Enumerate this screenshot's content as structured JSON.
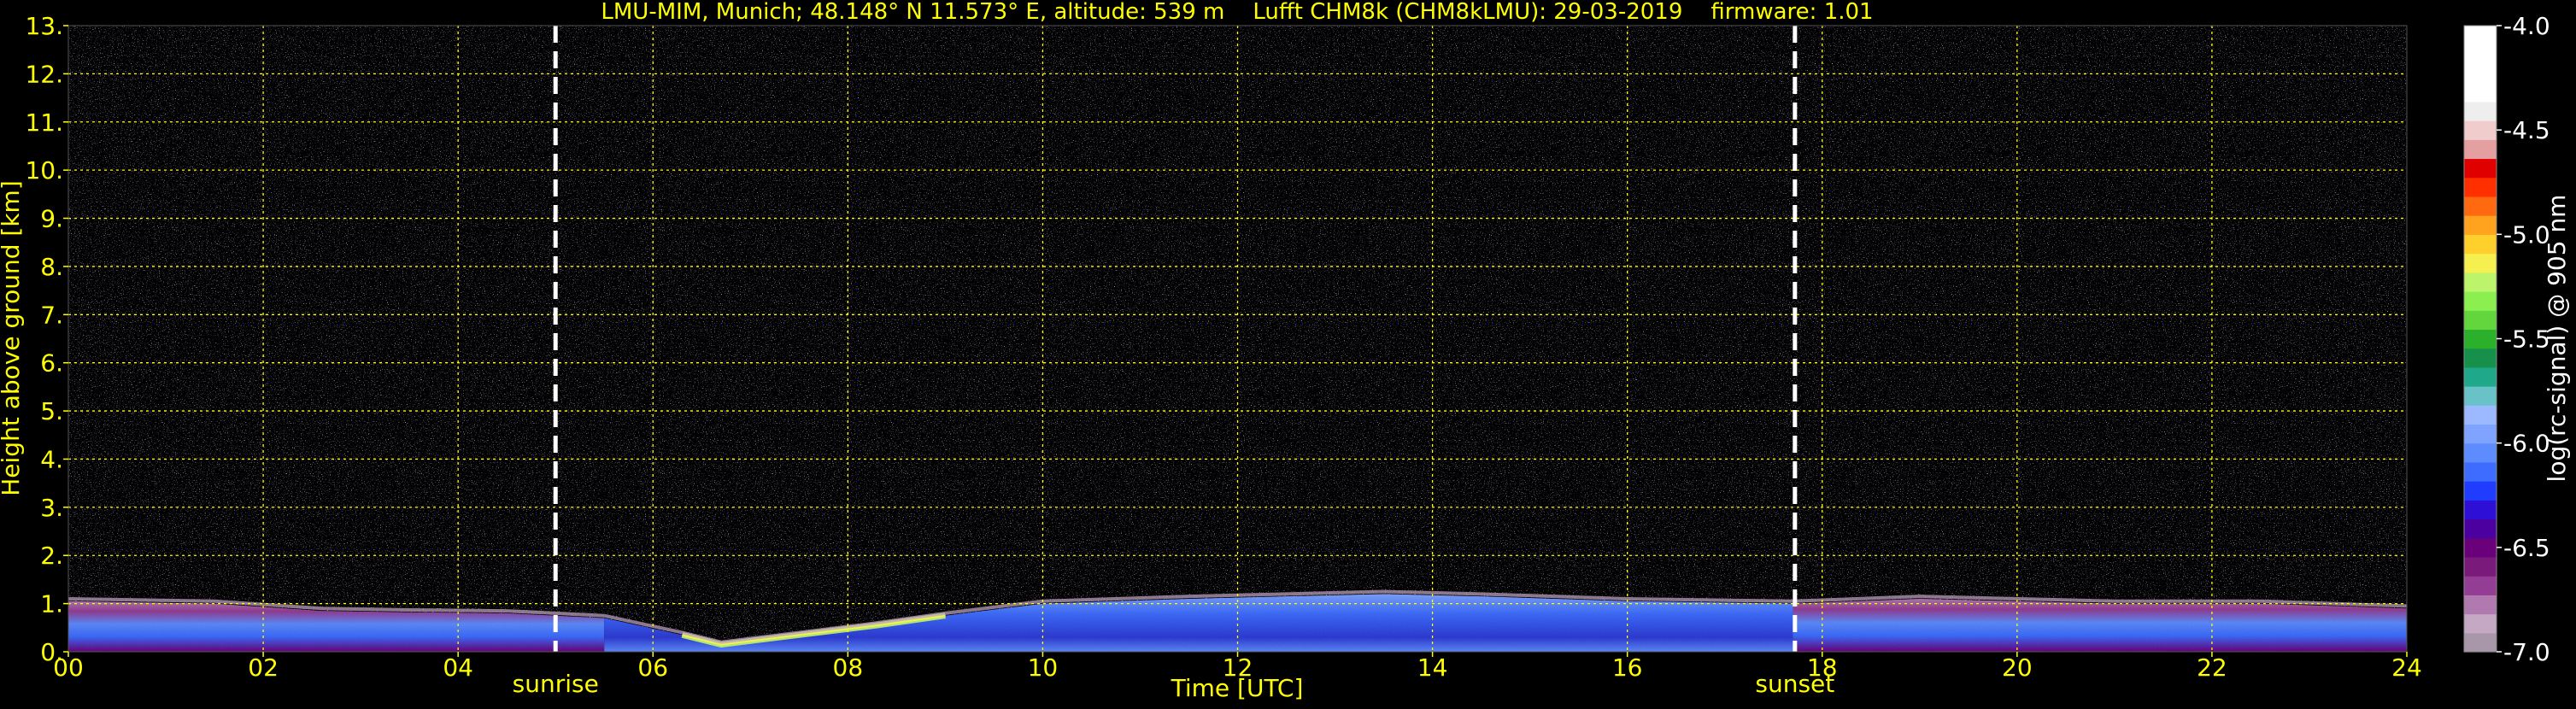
{
  "chart_data": {
    "type": "heatmap",
    "title": "LMU-MIM, Munich; 48.148° N 11.573° E, altitude: 539 m    Lufft CHM8k (CHM8kLMU): 29-03-2019    firmware: 1.01",
    "xlabel": "Time [UTC]",
    "ylabel": "Height above ground [km]",
    "x_ticks": [
      "00",
      "02",
      "04",
      "06",
      "08",
      "10",
      "12",
      "14",
      "16",
      "18",
      "20",
      "22",
      "24"
    ],
    "y_ticks": [
      "0.",
      "1.",
      "2.",
      "3.",
      "4.",
      "5.",
      "6.",
      "7.",
      "8.",
      "9.",
      "10.",
      "11.",
      "12.",
      "13."
    ],
    "xlim": [
      0,
      24
    ],
    "ylim": [
      0,
      13
    ],
    "grid": true,
    "colorbar": {
      "label": "log(rc-signal) @ 905 nm",
      "range": [
        -7.0,
        -4.0
      ],
      "ticks": [
        "-4.0",
        "-4.5",
        "-5.0",
        "-5.5",
        "-6.0",
        "-6.5",
        "-7.0"
      ],
      "colors": [
        "#a897a8",
        "#c4a8c4",
        "#b07ab0",
        "#943d94",
        "#7a1a7a",
        "#6a007a",
        "#4d00a0",
        "#2e0fd6",
        "#1f3cff",
        "#3d6cff",
        "#5e8cff",
        "#7ea4ff",
        "#9cb8ff",
        "#6ac2c9",
        "#1fa88a",
        "#16904a",
        "#2bb02b",
        "#63d63d",
        "#8cef50",
        "#bcf56c",
        "#f5f050",
        "#ffd02b",
        "#ffa31f",
        "#ff6a10",
        "#ff2f00",
        "#e00000",
        "#e4a0a0",
        "#f0cccc",
        "#eeeeee",
        "#ffffff",
        "#ffffff",
        "#ffffff",
        "#ffffff"
      ]
    },
    "annotations": [
      {
        "label": "sunrise",
        "x": 5.0
      },
      {
        "label": "sunset",
        "x": 17.72
      }
    ],
    "boundary_layer_top_km": [
      [
        0.0,
        1.05
      ],
      [
        1.5,
        1.0
      ],
      [
        2.6,
        0.85
      ],
      [
        3.5,
        0.82
      ],
      [
        4.5,
        0.8
      ],
      [
        5.5,
        0.7
      ],
      [
        6.3,
        0.35
      ],
      [
        6.7,
        0.15
      ],
      [
        7.5,
        0.35
      ],
      [
        8.3,
        0.55
      ],
      [
        9.0,
        0.75
      ],
      [
        10.0,
        1.0
      ],
      [
        11.5,
        1.1
      ],
      [
        13.5,
        1.2
      ],
      [
        14.5,
        1.15
      ],
      [
        16.0,
        1.05
      ],
      [
        17.7,
        1.0
      ],
      [
        19.0,
        1.1
      ],
      [
        21.0,
        1.0
      ],
      [
        22.5,
        1.0
      ],
      [
        24.0,
        0.9
      ]
    ],
    "colors": {
      "text": "#ffff00",
      "grid": "#ffff00",
      "annotation_line": "#ffffff",
      "background": "#000000"
    }
  }
}
